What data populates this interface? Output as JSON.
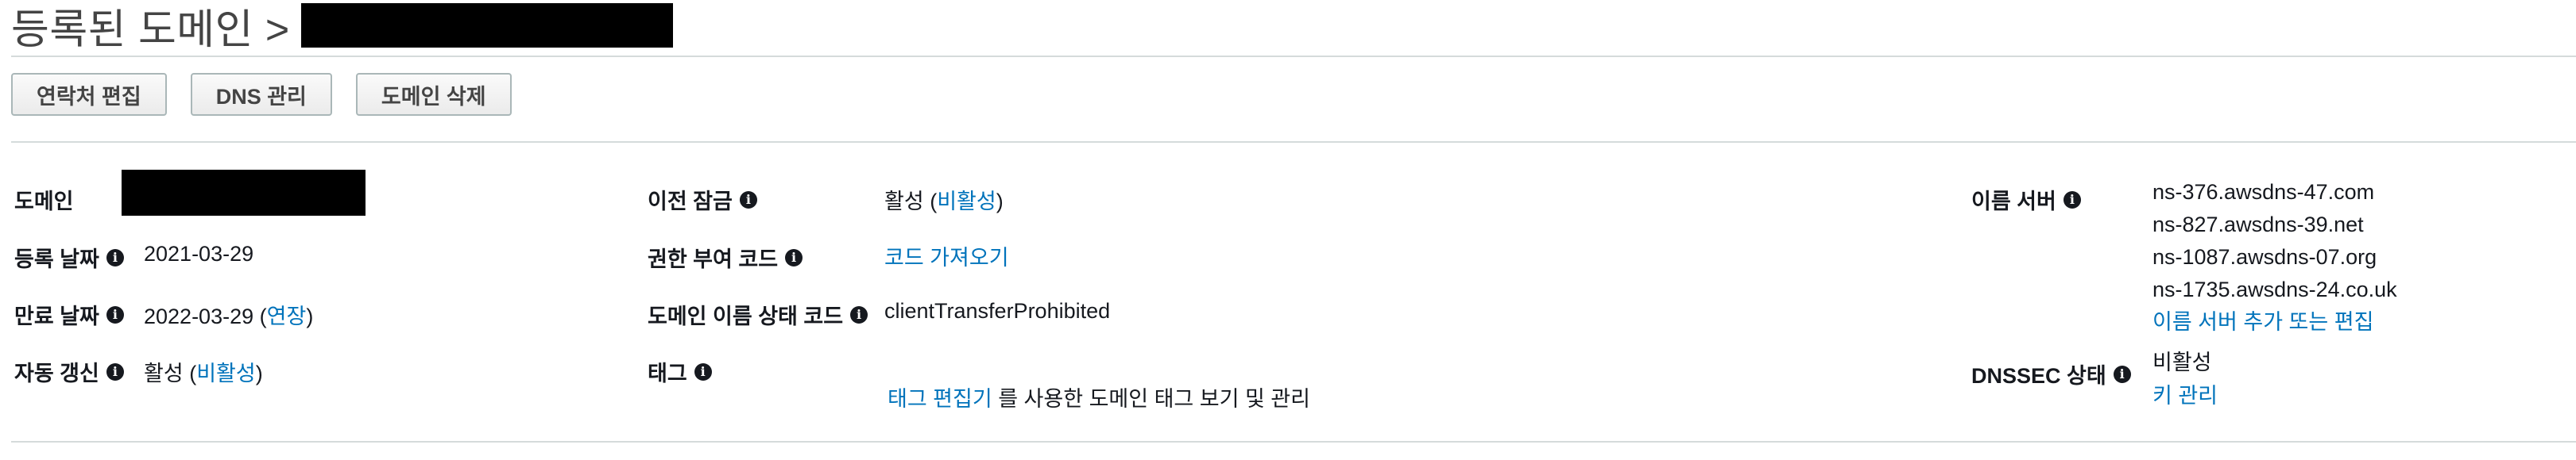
{
  "header": {
    "title": "등록된 도메인 >"
  },
  "toolbar": {
    "edit_contacts": "연락처 편집",
    "dns_manage": "DNS 관리",
    "delete_domain": "도메인 삭제"
  },
  "details": {
    "domain": {
      "label": "도메인"
    },
    "registered_date": {
      "label": "등록 날짜",
      "value": "2021-03-29"
    },
    "expiry_date": {
      "label": "만료 날짜",
      "value": "2022-03-29",
      "open": " (",
      "link": "연장",
      "close": ")"
    },
    "auto_renew": {
      "label": "자동 갱신",
      "value": "활성",
      "open": " (",
      "link": "비활성",
      "close": ")"
    },
    "transfer_lock": {
      "label": "이전 잠금",
      "value": "활성",
      "open": " (",
      "link": "비활성",
      "close": ")"
    },
    "auth_code": {
      "label": "권한 부여 코드",
      "link": "코드 가져오기"
    },
    "status_code": {
      "label": "도메인 이름 상태 코드",
      "value": "clientTransferProhibited"
    },
    "tags": {
      "label": "태그",
      "link": "태그 편집기",
      "text": " 를 사용한 도메인 태그 보기 및 관리"
    },
    "name_servers": {
      "label": "이름 서버",
      "servers": [
        "ns-376.awsdns-47.com",
        "ns-827.awsdns-39.net",
        "ns-1087.awsdns-07.org",
        "ns-1735.awsdns-24.co.uk"
      ],
      "edit_link": "이름 서버 추가 또는 편집"
    },
    "dnssec": {
      "label": "DNSSEC 상태",
      "value": "비활성",
      "link": "키 관리"
    }
  },
  "icons": {
    "info": "info-icon"
  },
  "colors": {
    "link": "#0073bb",
    "text": "#16191f",
    "divider": "#d5dbdb"
  }
}
